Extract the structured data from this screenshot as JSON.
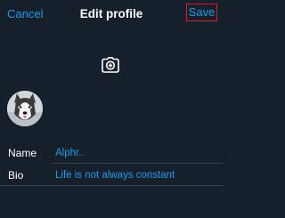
{
  "header": {
    "cancel_label": "Cancel",
    "title": "Edit profile",
    "save_label": "Save"
  },
  "banner": {
    "icon": "camera-plus-icon"
  },
  "avatar": {
    "icon": "husky-dog-avatar"
  },
  "fields": {
    "name": {
      "label": "Name",
      "value": "Alphr.."
    },
    "bio": {
      "label": "Bio",
      "value": "Life is not always constant"
    }
  },
  "colors": {
    "background": "#15202b",
    "accent": "#1d9bf0",
    "highlight": "#e0192c",
    "divider": "#38444d"
  }
}
